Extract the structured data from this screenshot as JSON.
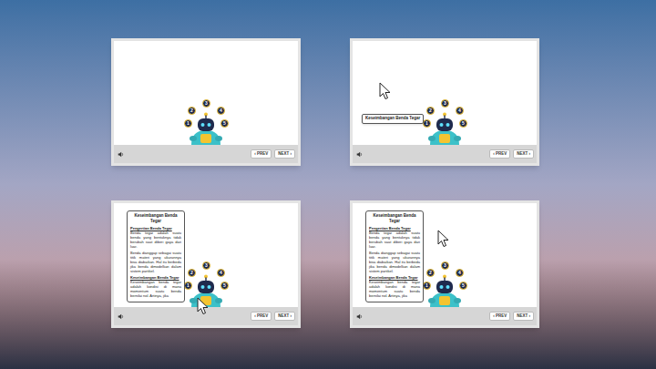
{
  "slides": [
    {
      "kind": "plain",
      "cursor": false,
      "markers": [
        "1",
        "2",
        "3",
        "4",
        "5"
      ],
      "buttons": [
        "‹ PREV",
        "NEXT ›"
      ]
    },
    {
      "kind": "tooltip",
      "cursor": true,
      "tooltip": "Keseimbangan Benda Tegar",
      "markers": [
        "1",
        "2",
        "3",
        "4",
        "5"
      ],
      "buttons": [
        "‹ PREV",
        "NEXT ›"
      ]
    },
    {
      "kind": "panel",
      "cursor": true,
      "markers": [
        "1",
        "2",
        "3",
        "4",
        "5"
      ],
      "buttons": [
        "‹ PREV",
        "NEXT ›"
      ],
      "panel": {
        "title": "Keseimbangan Benda Tegar",
        "sections": [
          {
            "heading": "Pengertian Benda Tegar",
            "paragraphs": [
              "Benda tegar adalah suatu benda yang bentuknya tidak berubah saat diberi gaya dari luar.",
              "Benda dianggap sebagai suatu titik materi yang ukurannya bisa diabaikan. Hal itu berbeda jika benda dimodelkan dalam sistem partikel."
            ]
          },
          {
            "heading": "Keseimbangan Benda Tegar",
            "paragraphs": [
              "Keseimbangan benda tegar adalah kondisi di mana momentum suatu benda bernilai nol. Artinya, jika"
            ]
          }
        ]
      }
    },
    {
      "kind": "panel",
      "cursor": true,
      "markers": [
        "1",
        "2",
        "3",
        "4",
        "5"
      ],
      "buttons": [
        "‹ PREV",
        "NEXT ›"
      ],
      "panel": {
        "title": "Keseimbangan Benda Tegar",
        "sections": [
          {
            "heading": "Pengertian Benda Tegar",
            "paragraphs": [
              "Benda tegar adalah suatu benda yang bentuknya tidak berubah saat diberi gaya dari luar.",
              "Benda dianggap sebagai suatu titik materi yang ukurannya bisa diabaikan. Hal itu berbeda jika benda dimodelkan dalam sistem partikel."
            ]
          },
          {
            "heading": "Keseimbangan Benda Tegar",
            "paragraphs": [
              "Keseimbangan benda tegar adalah kondisi di mana momentum suatu benda bernilai nol. Artinya, jika"
            ]
          }
        ]
      }
    }
  ]
}
